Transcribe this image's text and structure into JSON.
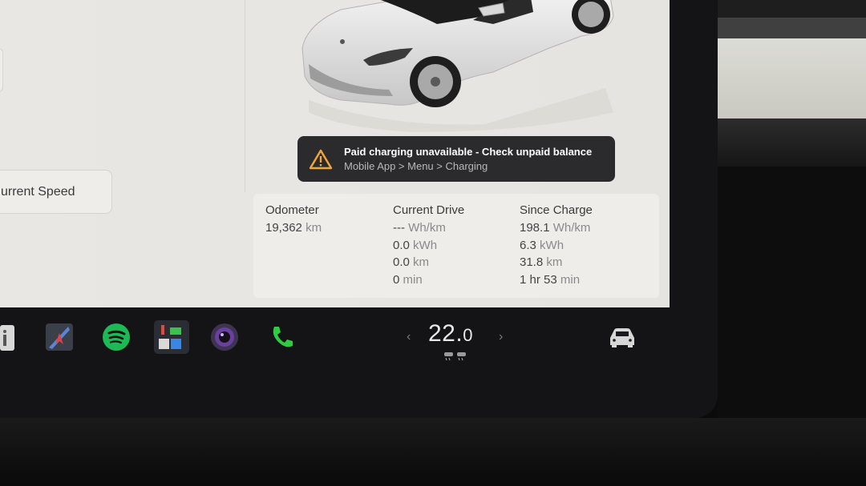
{
  "left_panel": {
    "current_speed_label": "urrent Speed"
  },
  "alert": {
    "title": "Paid charging unavailable - Check unpaid balance",
    "subtitle": "Mobile App > Menu > Charging",
    "icon": "warning-triangle-icon"
  },
  "trip": {
    "odometer": {
      "heading": "Odometer",
      "value": "19,362",
      "unit": "km"
    },
    "current_drive": {
      "heading": "Current Drive",
      "rows": [
        {
          "value": "---",
          "unit": "Wh/km"
        },
        {
          "value": "0.0",
          "unit": "kWh"
        },
        {
          "value": "0.0",
          "unit": "km"
        },
        {
          "value": "0",
          "unit": "min"
        }
      ]
    },
    "since_charge": {
      "heading": "Since Charge",
      "rows": [
        {
          "value": "198.1",
          "unit": "Wh/km"
        },
        {
          "value": "6.3",
          "unit": "kWh"
        },
        {
          "value": "31.8",
          "unit": "km"
        },
        {
          "value": "1 hr 53",
          "unit": "min"
        }
      ]
    }
  },
  "taskbar": {
    "apps": [
      "info-icon",
      "navigation-icon",
      "spotify-icon",
      "toybox-icon",
      "camera-icon",
      "phone-icon",
      "car-icon"
    ],
    "climate": {
      "temp_whole": "22.",
      "temp_decimal": "0",
      "left_arrow": "‹",
      "right_arrow": "›"
    }
  },
  "colors": {
    "spotify": "#1db954",
    "phone": "#2ecc40",
    "alert_bg": "#2b2b2d",
    "warning": "#f2a63a"
  }
}
